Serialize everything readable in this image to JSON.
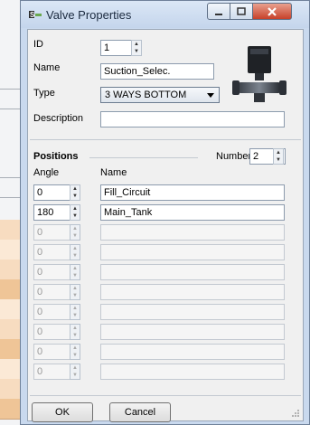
{
  "window": {
    "title": "Valve Properties"
  },
  "fields": {
    "id_label": "ID",
    "id_value": "1",
    "name_label": "Name",
    "name_value": "Suction_Selec.",
    "type_label": "Type",
    "type_value": "3 WAYS BOTTOM",
    "description_label": "Description",
    "description_value": ""
  },
  "positions": {
    "section_title": "Positions",
    "number_label": "Number",
    "number_value": "2",
    "angle_header": "Angle",
    "name_header": "Name",
    "rows": [
      {
        "angle": "0",
        "name": "Fill_Circuit",
        "enabled": true
      },
      {
        "angle": "180",
        "name": "Main_Tank",
        "enabled": true
      },
      {
        "angle": "0",
        "name": "",
        "enabled": false
      },
      {
        "angle": "0",
        "name": "",
        "enabled": false
      },
      {
        "angle": "0",
        "name": "",
        "enabled": false
      },
      {
        "angle": "0",
        "name": "",
        "enabled": false
      },
      {
        "angle": "0",
        "name": "",
        "enabled": false
      },
      {
        "angle": "0",
        "name": "",
        "enabled": false
      },
      {
        "angle": "0",
        "name": "",
        "enabled": false
      },
      {
        "angle": "0",
        "name": "",
        "enabled": false
      }
    ]
  },
  "buttons": {
    "ok": "OK",
    "cancel": "Cancel"
  },
  "icons": {
    "app": "valve-app-icon",
    "valve": "valve-image-icon"
  }
}
